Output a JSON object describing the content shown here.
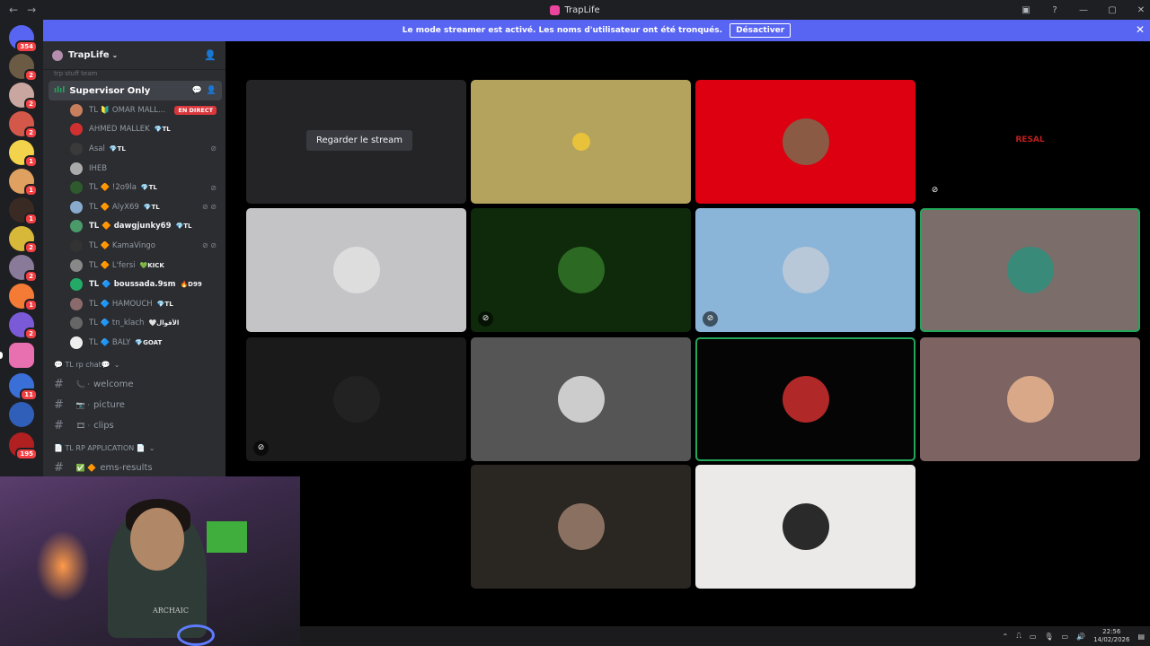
{
  "window": {
    "title": "TrapLife",
    "back_icon": "←",
    "forward_icon": "→"
  },
  "server_list": [
    {
      "badge": "354",
      "color": "#5865f2"
    },
    {
      "badge": "2",
      "color": "#6b5a44"
    },
    {
      "badge": "2",
      "color": "#c9a7a0"
    },
    {
      "badge": "2",
      "color": "#d4584a"
    },
    {
      "badge": "1",
      "color": "#f2d34b"
    },
    {
      "badge": "1",
      "color": "#e0a060"
    },
    {
      "badge": "1",
      "color": "#3a2a24"
    },
    {
      "badge": "2",
      "color": "#d8b838"
    },
    {
      "badge": "2",
      "color": "#8a7a9a"
    },
    {
      "badge": "1",
      "color": "#f47b35"
    },
    {
      "badge": "2",
      "color": "#7b5ad8"
    },
    {
      "badge": "",
      "color": "#e86fb0"
    },
    {
      "badge": "11",
      "color": "#3b6fd8"
    },
    {
      "badge": "",
      "color": "#2f5fb8"
    },
    {
      "badge": "195",
      "color": "#b02020"
    }
  ],
  "banner": {
    "text": "Le mode streamer est activé. Les noms d'utilisateur ont été tronqués.",
    "button": "Désactiver"
  },
  "guild": {
    "name": "TrapLife",
    "faded_row": "trp stuff team"
  },
  "voice_channel": {
    "name": "Supervisor Only"
  },
  "members": [
    {
      "name": "TL 🔰 OMAR MALL...",
      "tag": "",
      "live": "EN DIRECT",
      "color": "#c87f5e",
      "bright": false
    },
    {
      "name": "AHMED MALLEK",
      "tag": "💎TL",
      "color": "#d03030",
      "bright": false
    },
    {
      "name": "Asal",
      "tag": "💎TL",
      "color": "#3a3a3a",
      "bright": false
    },
    {
      "name": "IHEB",
      "tag": "",
      "color": "#aaaaaa",
      "bright": false
    },
    {
      "name": "TL 🔶 !2o9la",
      "tag": "💎TL",
      "color": "#2e5a2e",
      "bright": false
    },
    {
      "name": "TL 🔶 AlyX69",
      "tag": "💎TL",
      "color": "#88aacc",
      "bright": false
    },
    {
      "name": "TL 🔶 dawgjunky69",
      "tag": "💎TL",
      "color": "#4a9a6a",
      "bright": true
    },
    {
      "name": "TL 🔶 KamaVingo",
      "tag": "",
      "color": "#333333",
      "bright": false
    },
    {
      "name": "TL 🔶 L'fersi",
      "tag": "💚KICK",
      "color": "#888888",
      "bright": false
    },
    {
      "name": "TL 🔷 boussada.9sm",
      "tag": "🔥D99",
      "color": "#22aa66",
      "bright": true
    },
    {
      "name": "TL 🔷 HAMOUCH",
      "tag": "💎TL",
      "color": "#8a6a6a",
      "bright": false
    },
    {
      "name": "TL 🔷 tn_klach",
      "tag": "🤍الأقوال",
      "color": "#666666",
      "bright": false
    },
    {
      "name": "TL 🔷 BALY",
      "tag": "💎GOAT",
      "color": "#eeeeee",
      "bright": false
    }
  ],
  "categories": [
    {
      "label": "💬 TL rp chat💬"
    },
    {
      "label": "📄 TL RP APPLICATION 📄"
    }
  ],
  "channels": [
    {
      "prefix": "📞 ·",
      "name": "welcome"
    },
    {
      "prefix": "📷 ·",
      "name": "picture"
    },
    {
      "prefix": "🎞 ·",
      "name": "clips"
    },
    {
      "prefix": "✅ 🔶",
      "name": "ems-results"
    }
  ],
  "stage": {
    "watch_button": "Regarder le stream",
    "tiles": [
      {
        "bg": "#242427",
        "avatar": "",
        "speaking": false
      },
      {
        "bg": "#b3a35c",
        "avatar": "#e8c23a",
        "speaking": false
      },
      {
        "bg": "#dc0011",
        "avatar": "#8a5a44",
        "speaking": false
      },
      {
        "bg": "#000000",
        "avatar": "",
        "logo": "RESAL",
        "speaking": false
      },
      {
        "bg": "#c4c4c6",
        "avatar": "#dddddd",
        "speaking": false
      },
      {
        "bg": "#0e2a0a",
        "avatar": "#2c6a24",
        "speaking": false
      },
      {
        "bg": "#8ab4d8",
        "avatar": "#b8c8d8",
        "speaking": false
      },
      {
        "bg": "#7a6d6a",
        "avatar": "#3a8a7a",
        "speaking": true
      },
      {
        "bg": "#1a1a1a",
        "avatar": "#222222",
        "speaking": false
      },
      {
        "bg": "#555556",
        "avatar": "#cccccc",
        "speaking": false
      },
      {
        "bg": "#050505",
        "avatar": "#b02828",
        "speaking": true
      },
      {
        "bg": "#7d6463",
        "avatar": "#d8a888",
        "speaking": false
      },
      {
        "bg": "#2a2622",
        "avatar": "#8a7060",
        "speaking": false
      },
      {
        "bg": "#ebeae8",
        "avatar": "#2a2a2a",
        "speaking": false
      }
    ]
  },
  "webcam_overlay": {
    "shirt_text": "ARCHAIC"
  },
  "taskbar": {
    "time": "22:56",
    "date": "14/02/2026"
  }
}
